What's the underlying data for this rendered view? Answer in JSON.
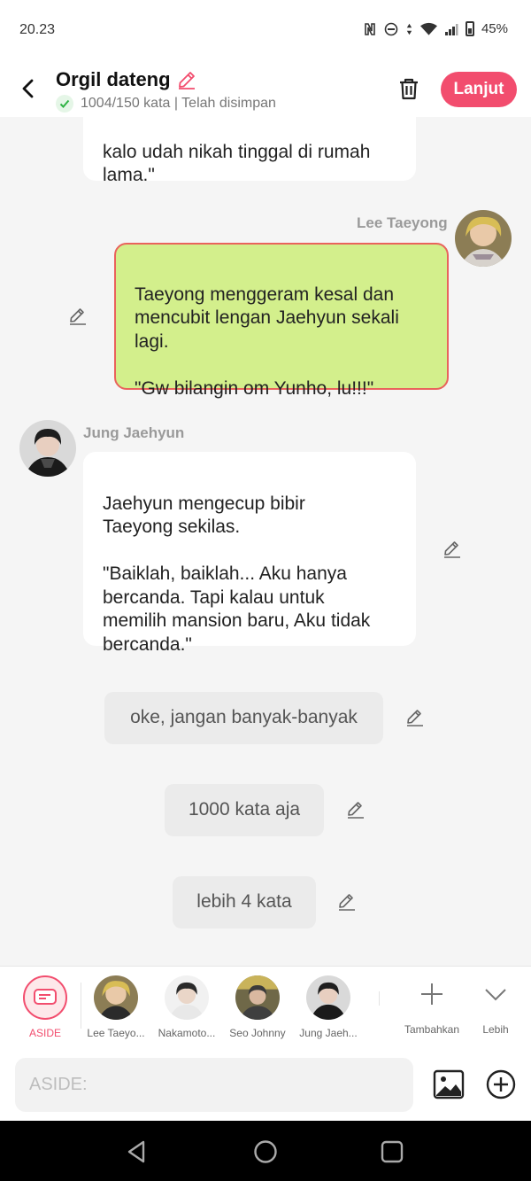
{
  "status_bar": {
    "time": "20.23",
    "battery": "45%"
  },
  "header": {
    "title": "Orgil dateng",
    "subtitle": "1004/150 kata | Telah disimpan",
    "next_button": "Lanjut"
  },
  "messages": [
    {
      "type": "narration",
      "text": "kalo udah nikah tinggal di rumah\nlama.\""
    },
    {
      "type": "character",
      "side": "right",
      "speaker": "Lee Taeyong",
      "text": "Taeyong menggeram kesal dan\nmencubit lengan Jaehyun sekali\nlagi.\n\n\"Gw bilangin om Yunho, lu!!!\""
    },
    {
      "type": "character",
      "side": "left",
      "speaker": "Jung Jaehyun",
      "text": "Jaehyun mengecup bibir\nTaeyong sekilas.\n\n\"Baiklah, baiklah... Aku hanya\nbercanda. Tapi kalau untuk\nmemilih mansion baru, Aku tidak\nbercanda.\""
    },
    {
      "type": "aside",
      "text": "oke, jangan banyak-banyak"
    },
    {
      "type": "aside",
      "text": "1000 kata aja"
    },
    {
      "type": "aside",
      "text": "lebih 4 kata"
    }
  ],
  "character_bar": {
    "aside_label": "ASIDE",
    "characters": [
      {
        "label": "Lee Taeyo..."
      },
      {
        "label": "Nakamoto..."
      },
      {
        "label": "Seo Johnny"
      },
      {
        "label": "Jung Jaeh..."
      }
    ],
    "add_label": "Tambahkan",
    "more_label": "Lebih"
  },
  "input": {
    "placeholder": "ASIDE:"
  },
  "colors": {
    "accent": "#f24d6e",
    "user_bubble": "#d3ef8c",
    "user_bubble_border": "#e9635c",
    "aside_bubble": "#ebebeb"
  }
}
